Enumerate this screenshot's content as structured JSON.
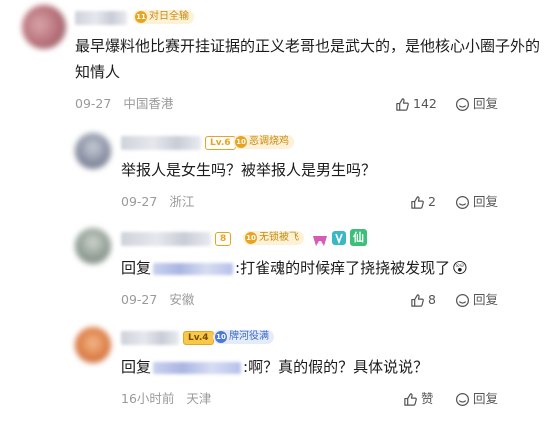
{
  "comments": [
    {
      "badge_text": "对日全输",
      "badge_level": "11",
      "text_line1": "最早爆料他比赛开挂证据的正义老哥也是武大的，是他核心小圈子外的",
      "text_line2": "知情人",
      "date": "09-27",
      "location": "中国香港",
      "likes": "142",
      "reply_label": "回复"
    },
    {
      "level": "Lv.6",
      "badge_level": "10",
      "badge_text": "恶调烧鸡",
      "text": "举报人是女生吗？被举报人是男生吗？",
      "date": "09-27",
      "location": "浙江",
      "likes": "2",
      "reply_label": "回复"
    },
    {
      "level": "8",
      "badge_level": "10",
      "badge_text": "无锁被飞",
      "tag_text": "仙",
      "reply_prefix": "回复",
      "text": ":打雀魂的时候痒了挠挠被发现了",
      "emoji": "😲",
      "date": "09-27",
      "location": "安徽",
      "likes": "8",
      "reply_label": "回复"
    },
    {
      "level": "Lv.4",
      "badge_level": "10",
      "badge_text": "牌河役满",
      "reply_prefix": "回复",
      "text": ":啊？真的假的？具体说说？",
      "date": "16小时前",
      "location": "天津",
      "likes": "赞",
      "reply_label": "回复"
    }
  ],
  "colors": {
    "gold": "#e9a31f",
    "blue": "#4a78d8",
    "gray_text": "#9a9a9a"
  }
}
